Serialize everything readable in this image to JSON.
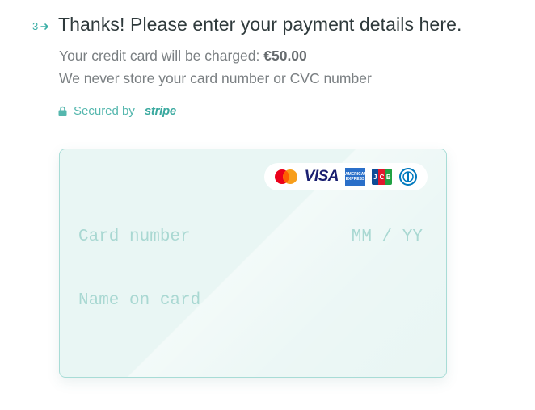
{
  "question": {
    "number": "3",
    "title": "Thanks! Please enter your payment details here.",
    "charge_prefix": "Your credit card will be charged: ",
    "charge_amount": "€50.00",
    "privacy_note": "We never store your card number or CVC number"
  },
  "secured": {
    "label": "Secured by",
    "brand": "stripe",
    "color": "#55b7ae"
  },
  "card": {
    "logos": [
      "mastercard-icon",
      "visa-icon",
      "amex-icon",
      "jcb-icon",
      "diners-icon"
    ],
    "visa_text": "VISA",
    "jcb_text": "JCB",
    "amex_text_top": "AMERICAN",
    "amex_text_bottom": "EXPRESS",
    "card_number_placeholder": "Card number",
    "expiry_placeholder": "MM / YY",
    "name_placeholder": "Name on card",
    "background": "#e9f6f4",
    "border": "#a8dcd6"
  },
  "colors": {
    "accent": "#3aaea6",
    "text": "#2f3a3c",
    "muted": "#7a7f82"
  }
}
